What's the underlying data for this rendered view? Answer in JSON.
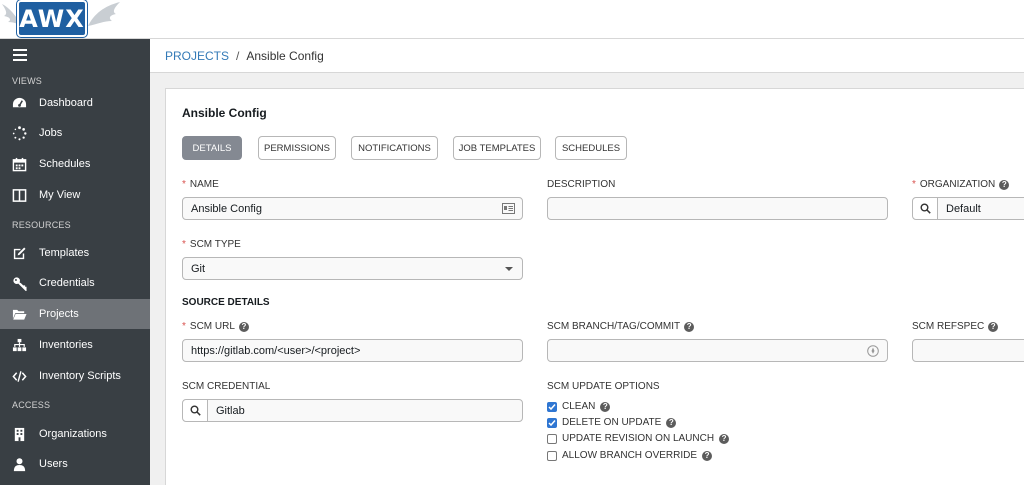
{
  "app": {
    "logo_text": "AWX"
  },
  "sidebar": {
    "sections": [
      {
        "label": "VIEWS"
      },
      {
        "label": "RESOURCES"
      },
      {
        "label": "ACCESS"
      }
    ],
    "items": [
      {
        "label": "Dashboard"
      },
      {
        "label": "Jobs"
      },
      {
        "label": "Schedules"
      },
      {
        "label": "My View"
      },
      {
        "label": "Templates"
      },
      {
        "label": "Credentials"
      },
      {
        "label": "Projects",
        "active": true
      },
      {
        "label": "Inventories"
      },
      {
        "label": "Inventory Scripts"
      },
      {
        "label": "Organizations"
      },
      {
        "label": "Users"
      }
    ]
  },
  "breadcrumb": {
    "parent": "PROJECTS",
    "separator": "/",
    "current": "Ansible Config"
  },
  "panel": {
    "title": "Ansible Config",
    "tabs": [
      {
        "label": "DETAILS",
        "active": true
      },
      {
        "label": "PERMISSIONS"
      },
      {
        "label": "NOTIFICATIONS"
      },
      {
        "label": "JOB TEMPLATES"
      },
      {
        "label": "SCHEDULES"
      }
    ]
  },
  "form": {
    "name": {
      "label": "NAME",
      "value": "Ansible Config"
    },
    "description": {
      "label": "DESCRIPTION",
      "value": ""
    },
    "organization": {
      "label": "ORGANIZATION",
      "value": "Default"
    },
    "scm_type": {
      "label": "SCM TYPE",
      "value": "Git"
    },
    "source_details": "SOURCE DETAILS",
    "scm_url": {
      "label": "SCM URL",
      "value": "https://gitlab.com/<user>/<project>"
    },
    "scm_branch": {
      "label": "SCM BRANCH/TAG/COMMIT",
      "value": ""
    },
    "scm_refspec": {
      "label": "SCM REFSPEC",
      "value": ""
    },
    "scm_credential": {
      "label": "SCM CREDENTIAL",
      "value": "Gitlab"
    },
    "scm_update_options": {
      "label": "SCM UPDATE OPTIONS",
      "options": [
        {
          "label": "CLEAN",
          "checked": true
        },
        {
          "label": "DELETE ON UPDATE",
          "checked": true
        },
        {
          "label": "UPDATE REVISION ON LAUNCH",
          "checked": false
        },
        {
          "label": "ALLOW BRANCH OVERRIDE",
          "checked": false
        }
      ]
    }
  },
  "colors": {
    "sidebar": "#393f44",
    "active_nav": "#6e7277",
    "link": "#337ab7",
    "required": "#d9534f",
    "checkbox": "#2f76d2"
  }
}
